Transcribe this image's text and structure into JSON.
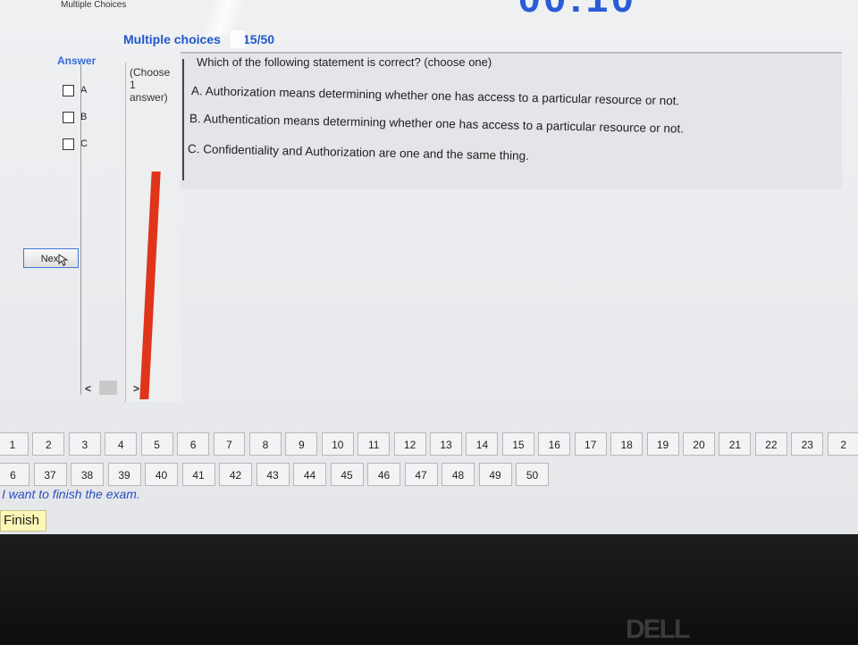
{
  "window": {
    "title": "Multiple Choices",
    "timer_fragment": "00:10"
  },
  "section": {
    "title": "Multiple choices",
    "count": "15/50"
  },
  "answer_panel": {
    "header": "Answer",
    "options": [
      {
        "label": "A"
      },
      {
        "label": "B"
      },
      {
        "label": "C"
      }
    ],
    "choose_line1": "(Choose",
    "choose_line2": "1",
    "choose_line3": "answer)"
  },
  "question": {
    "text": "Which of the following statement is correct? (choose one)",
    "options": [
      "A. Authorization means determining whether one has access to a particular resource or not.",
      "B. Authentication means determining whether one has access to a particular resource or not.",
      "C. Confidentiality and Authorization are one and the same thing."
    ]
  },
  "navigation": {
    "next_label": "Next",
    "scroll_left": "<",
    "scroll_right": ">"
  },
  "question_nav": {
    "row1": [
      "1",
      "2",
      "3",
      "4",
      "5",
      "6",
      "7",
      "8",
      "9",
      "10",
      "11",
      "12",
      "13",
      "14",
      "15",
      "16",
      "17",
      "18",
      "19",
      "20",
      "21",
      "22",
      "23",
      "2"
    ],
    "row2": [
      "6",
      "37",
      "38",
      "39",
      "40",
      "41",
      "42",
      "43",
      "44",
      "45",
      "46",
      "47",
      "48",
      "49",
      "50"
    ]
  },
  "finish": {
    "prompt": "I want to finish the exam.",
    "button_label": "Finish"
  },
  "bezel": {
    "brand": "DELL"
  },
  "colors": {
    "accent": "#2257c9",
    "red_bar": "#e0341b",
    "finish_bg": "#fbf7b6"
  }
}
